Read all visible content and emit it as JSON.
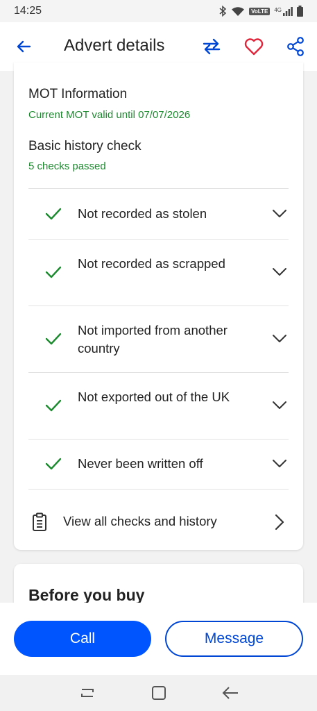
{
  "status_bar": {
    "time": "14:25",
    "volte": "VoLTE",
    "network": "4G",
    "icons": [
      "bluetooth-icon",
      "wifi-icon",
      "signal-icon",
      "battery-icon"
    ]
  },
  "header": {
    "title": "Advert details",
    "accent_color": "#0046d5",
    "favourite_color": "#e0243a"
  },
  "mot": {
    "title": "MOT Information",
    "status": "Current MOT valid until 07/07/2026"
  },
  "history": {
    "title": "Basic history check",
    "summary": "5 checks passed",
    "checks": [
      {
        "label": "Not recorded as stolen",
        "status": "passed"
      },
      {
        "label": "Not recorded as scrapped",
        "status": "passed"
      },
      {
        "label": "Not imported from another country",
        "status": "passed"
      },
      {
        "label": "Not exported out of the UK",
        "status": "passed"
      },
      {
        "label": "Never been written off",
        "status": "passed"
      }
    ],
    "view_all": "View all checks and history"
  },
  "before_you_buy": {
    "title": "Before you buy"
  },
  "actions": {
    "call": "Call",
    "message": "Message",
    "primary_color": "#0055ff"
  }
}
